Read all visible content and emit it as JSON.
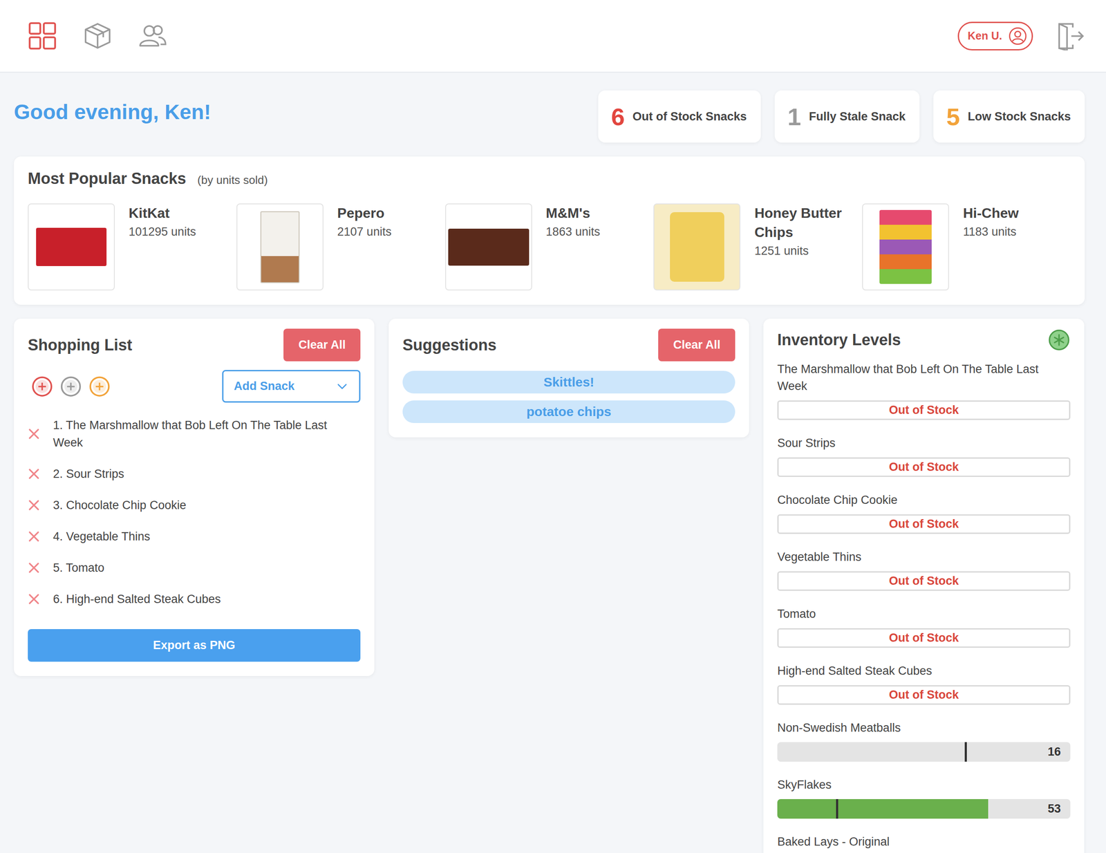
{
  "nav": {
    "items": [
      {
        "selected": true
      },
      {
        "selected": false
      },
      {
        "selected": false
      }
    ]
  },
  "user": {
    "name": "Ken U."
  },
  "greeting": "Good evening, Ken!",
  "stats": [
    {
      "count": "6",
      "label": "Out of Stock Snacks",
      "color": "#e2463f"
    },
    {
      "count": "1",
      "label": "Fully Stale Snack",
      "color": "#9a9a9a"
    },
    {
      "count": "5",
      "label": "Low Stock Snacks",
      "color": "#f2a33a"
    }
  ],
  "popular": {
    "title": "Most Popular Snacks",
    "subtitle": "(by units sold)",
    "items": [
      {
        "name": "KitKat",
        "units": "101295 units"
      },
      {
        "name": "Pepero",
        "units": "2107 units"
      },
      {
        "name": "M&M's",
        "units": "1863 units"
      },
      {
        "name": "Honey Butter Chips",
        "units": "1251 units"
      },
      {
        "name": "Hi-Chew",
        "units": "1183 units"
      }
    ]
  },
  "shopping_list": {
    "title": "Shopping List",
    "clear_button": "Clear All",
    "filters": [
      {
        "color": "#e0524f"
      },
      {
        "color": "#9a9a9a"
      },
      {
        "color": "#f2a33a"
      }
    ],
    "add_snack": "Add Snack",
    "items": [
      "1. The Marshmallow that Bob Left On The Table Last Week",
      "2. Sour Strips",
      "3. Chocolate Chip Cookie",
      "4. Vegetable Thins",
      "5. Tomato",
      "6. High-end Salted Steak Cubes"
    ],
    "export_button": "Export as PNG"
  },
  "suggestions": {
    "title": "Suggestions",
    "clear_button": "Clear All",
    "items": [
      "Skittles!",
      "potatoe chips"
    ]
  },
  "inventory": {
    "title": "Inventory Levels",
    "items": [
      {
        "name": "The Marshmallow that Bob Left On The Table Last Week",
        "kind": "out",
        "status": "Out of Stock"
      },
      {
        "name": "Sour Strips",
        "kind": "out",
        "status": "Out of Stock"
      },
      {
        "name": "Chocolate Chip Cookie",
        "kind": "out",
        "status": "Out of Stock"
      },
      {
        "name": "Vegetable Thins",
        "kind": "out",
        "status": "Out of Stock"
      },
      {
        "name": "Tomato",
        "kind": "out",
        "status": "Out of Stock"
      },
      {
        "name": "High-end Salted Steak Cubes",
        "kind": "out",
        "status": "Out of Stock"
      },
      {
        "name": "Non-Swedish Meatballs",
        "kind": "level",
        "level": 0,
        "threshold": 0.64,
        "reading": "16"
      },
      {
        "name": "SkyFlakes",
        "kind": "level",
        "level": 0.72,
        "threshold": 0.2,
        "reading": "53"
      },
      {
        "name": "Baked Lays - Original",
        "kind": "partial"
      }
    ]
  }
}
